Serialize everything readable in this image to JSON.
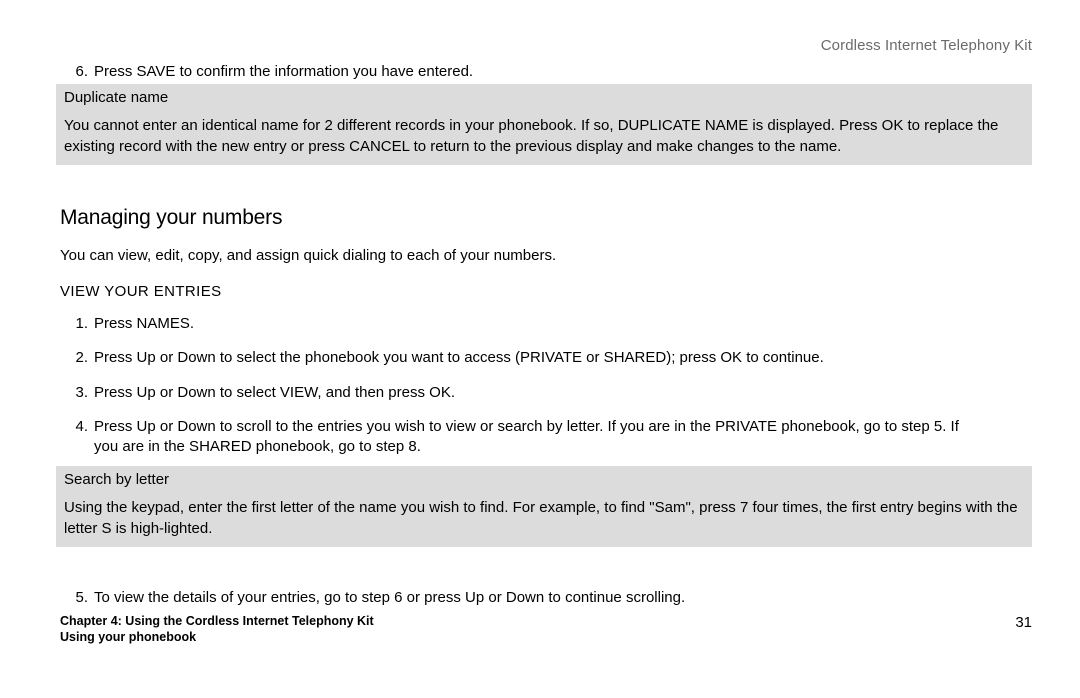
{
  "header": {
    "product_title": "Cordless Internet Telephony Kit"
  },
  "top_step": {
    "num": "6.",
    "text": "Press SAVE to confirm the information you have entered."
  },
  "duplicate_note": {
    "title": "Duplicate name",
    "body": "You cannot enter an identical name for 2 different records in your phonebook. If so, DUPLICATE NAME is displayed. Press OK to replace the existing record with the new entry or press CANCEL to return to the previous display and make changes to the name."
  },
  "section": {
    "heading": "Managing your numbers",
    "intro": "You can view, edit, copy, and assign quick dialing to each of your numbers.",
    "subhead": "VIEW YOUR ENTRIES"
  },
  "steps": [
    {
      "num": "1.",
      "text": "Press NAMES."
    },
    {
      "num": "2.",
      "text": "Press Up or Down to select the phonebook you want to access (PRIVATE or SHARED); press OK to continue."
    },
    {
      "num": "3.",
      "text": "Press Up or Down to select VIEW, and then press OK."
    },
    {
      "num": "4.",
      "text": "Press Up or Down to scroll to the entries you wish to view or search by letter. If you are in the PRIVATE phonebook, go to step 5. If you are in the SHARED phonebook, go to step 8."
    }
  ],
  "search_note": {
    "title": "Search by letter",
    "body": "Using the keypad, enter the first letter of the name you wish to find. For example, to find \"Sam\", press 7 four times, the first entry begins with the letter S is high-lighted."
  },
  "step5": {
    "num": "5.",
    "text": "To view the details of your entries, go to step 6 or press Up or Down to continue scrolling."
  },
  "footer": {
    "chapter": "Chapter 4: Using the Cordless Internet Telephony Kit",
    "subsection": "Using your phonebook",
    "page": "31"
  }
}
